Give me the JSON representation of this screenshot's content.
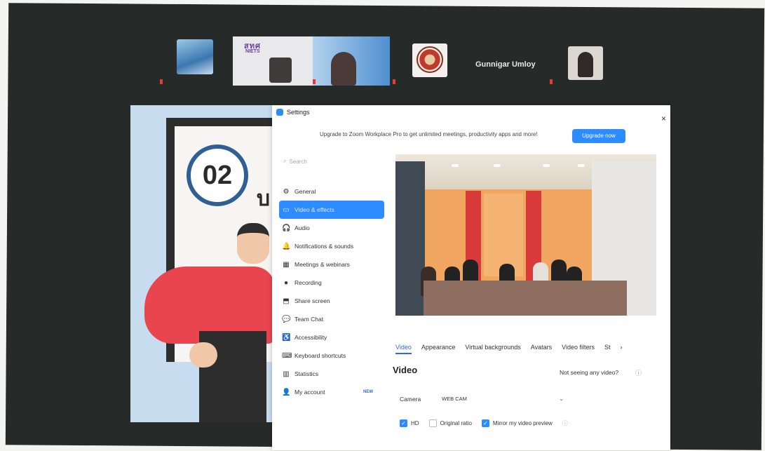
{
  "participants": {
    "featured_name": "Gunnigar Umloy"
  },
  "slide": {
    "badge": "02",
    "letter": "บ"
  },
  "settings": {
    "title": "Settings",
    "close": "×",
    "upgrade_text": "Upgrade to Zoom Workplace Pro to get unlimited meetings, productivity apps and more!",
    "upgrade_button": "Upgrade now",
    "search_placeholder": "Search",
    "sidebar": [
      {
        "label": "General",
        "icon": "gear-icon",
        "glyph": "⚙"
      },
      {
        "label": "Video & effects",
        "icon": "video-icon",
        "glyph": "▭",
        "active": true
      },
      {
        "label": "Audio",
        "icon": "headphones-icon",
        "glyph": "🎧"
      },
      {
        "label": "Notifications & sounds",
        "icon": "bell-icon",
        "glyph": "🔔"
      },
      {
        "label": "Meetings & webinars",
        "icon": "calendar-icon",
        "glyph": "▦"
      },
      {
        "label": "Recording",
        "icon": "record-icon",
        "glyph": "●"
      },
      {
        "label": "Share screen",
        "icon": "share-screen-icon",
        "glyph": "⬒"
      },
      {
        "label": "Team Chat",
        "icon": "chat-icon",
        "glyph": "💬"
      },
      {
        "label": "Accessibility",
        "icon": "accessibility-icon",
        "glyph": "♿"
      },
      {
        "label": "Keyboard shortcuts",
        "icon": "keyboard-icon",
        "glyph": "⌨"
      },
      {
        "label": "Statistics",
        "icon": "statistics-icon",
        "glyph": "▥"
      },
      {
        "label": "My account",
        "icon": "account-icon",
        "glyph": "👤",
        "badge": "NEW"
      }
    ],
    "tabs": [
      "Video",
      "Appearance",
      "Virtual backgrounds",
      "Avatars",
      "Video filters",
      "St"
    ],
    "tab_more": "›",
    "video_heading": "Video",
    "not_seeing": "Not seeing any video?",
    "camera_label": "Camera",
    "camera_value": "WEB CAM",
    "options": {
      "hd": "HD",
      "original_ratio": "Original ratio",
      "mirror": "Mirror my video preview"
    }
  },
  "colors": {
    "accent": "#2d8cff",
    "meeting_bg": "#262a28"
  }
}
